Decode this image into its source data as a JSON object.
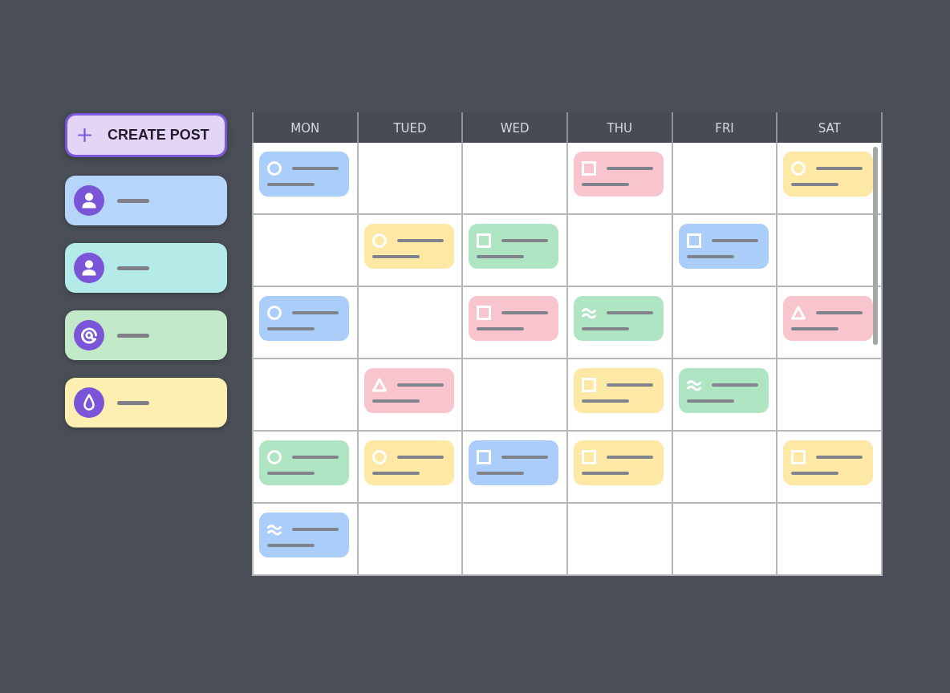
{
  "sidebar": {
    "create_button": {
      "label": "CREATE POST"
    },
    "items": [
      {
        "kind": "person",
        "color": "#b5d5fb"
      },
      {
        "kind": "person",
        "color": "#b4ebe9"
      },
      {
        "kind": "at",
        "color": "#c2eac9"
      },
      {
        "kind": "drop",
        "color": "#fdefb1"
      }
    ]
  },
  "calendar": {
    "columns": [
      "MON",
      "TUED",
      "WED",
      "THU",
      "FRI",
      "SAT"
    ],
    "rows": [
      [
        {
          "kind": "circle",
          "color": "#aacdf9"
        },
        null,
        null,
        {
          "kind": "square",
          "color": "#f8c5cf"
        },
        null,
        {
          "kind": "circle",
          "color": "#fde8a5"
        }
      ],
      [
        null,
        {
          "kind": "circle",
          "color": "#fde8a5"
        },
        {
          "kind": "square",
          "color": "#b0e5c3"
        },
        null,
        {
          "kind": "square",
          "color": "#aacdf9"
        },
        null
      ],
      [
        {
          "kind": "circle",
          "color": "#aacdf9"
        },
        null,
        {
          "kind": "square",
          "color": "#f8c5cf"
        },
        {
          "kind": "wave",
          "color": "#b0e5c3"
        },
        null,
        {
          "kind": "triangle",
          "color": "#f8c5cf"
        }
      ],
      [
        null,
        {
          "kind": "triangle",
          "color": "#f8c5cf"
        },
        null,
        {
          "kind": "square",
          "color": "#fde8a5"
        },
        {
          "kind": "wave",
          "color": "#b0e5c3"
        },
        null
      ],
      [
        {
          "kind": "circle",
          "color": "#b0e5c3"
        },
        {
          "kind": "circle",
          "color": "#fde8a5"
        },
        {
          "kind": "square",
          "color": "#aacdf9"
        },
        {
          "kind": "square",
          "color": "#fde8a5"
        },
        null,
        {
          "kind": "square",
          "color": "#fde8a5"
        }
      ],
      [
        {
          "kind": "wave",
          "color": "#aacdf9"
        },
        null,
        null,
        null,
        null,
        null
      ]
    ]
  }
}
